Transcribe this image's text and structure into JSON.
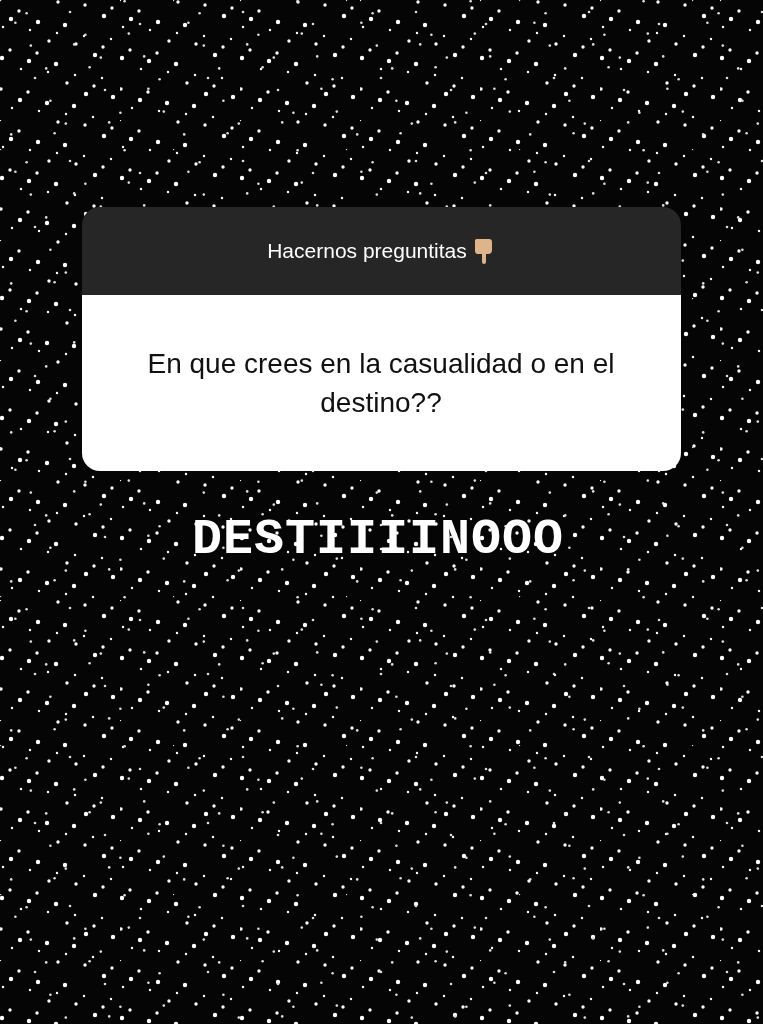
{
  "question_sticker": {
    "title": "Hacernos preguntitas",
    "question": "En que crees en la casualidad o en el destino??"
  },
  "answer": "DESTIIIINOOO"
}
